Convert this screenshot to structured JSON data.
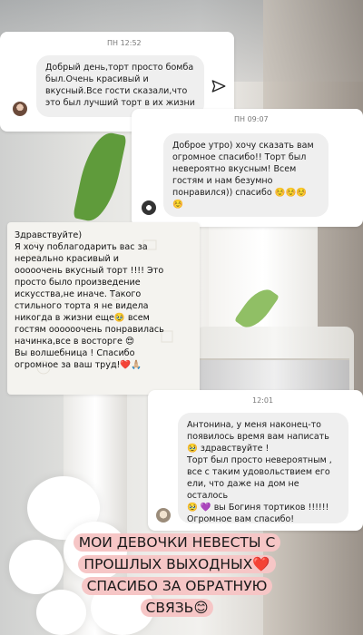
{
  "chat": {
    "time1": "ПН 12:52",
    "msg1": "Добрый день,торт просто бомба\nбыл.Очень красивый и\nвкусный.Все гости сказали,что\nэто был лучший торт в их жизни",
    "time2": "ПН 09:07",
    "msg2": "Доброе утро) хочу сказать вам\nогромное спасибо!! Торт был\nневероятно вкусным! Всем\nгостям и нам безумно\nпонравился)) спасибо ☺️☺️☺️\n☺️",
    "msg3": "Здравствуйте)\nЯ хочу поблагодарить вас за\nнереально красивый и\nооооочень вкусный торт !!!! Это\nпросто было произведение\nискусства,не иначе. Такого\nстильного торта я не видела\nникогда в жизни еще🥹 всем\nгостям оооооочень понравилась\nначинка,все в восторге 😍\nВы волшебница ! Спасибо\nогромное за ваш труд!❤️🙏🏼",
    "time4": "12:01",
    "msg4": "Антонина, у меня наконец-то\nпоявилось время вам написать\n🥹 здравствуйте !\nТорт был просто невероятным ,\nвсе с таким удовольствием его\nели, что даже на дом не осталось\n🥹 💜 вы Богиня тортиков !!!!!!\nОгромное вам спасибо!"
  },
  "caption": {
    "line1": "МОИ ДЕВОЧКИ НЕВЕСТЫ С",
    "line2": "ПРОШЛЫХ ВЫХОДНЫХ❤️",
    "line3": "СПАСИБО ЗА ОБРАТНУЮ",
    "line4": "СВЯЗЬ😊"
  },
  "icons": {
    "send": "send-icon",
    "avatar1": "avatar-photo-icon",
    "avatar2": "avatar-photo-icon",
    "avatar4": "avatar-photo-icon"
  }
}
